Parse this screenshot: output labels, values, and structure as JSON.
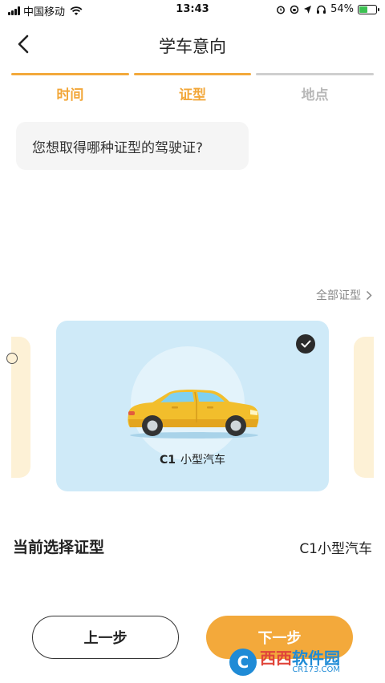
{
  "status_bar": {
    "carrier": "中国移动",
    "time": "13:43",
    "battery_text": "54%",
    "battery_level": 0.54,
    "battery_color": "#3cc152"
  },
  "header": {
    "back_icon": "chevron-left-icon",
    "title": "学车意向"
  },
  "steps": [
    {
      "label": "时间",
      "active": true
    },
    {
      "label": "证型",
      "active": true
    },
    {
      "label": "地点",
      "active": false
    }
  ],
  "question": "您想取得哪种证型的驾驶证?",
  "all_types_link": "全部证型",
  "carousel": {
    "selected_card": {
      "code": "C1",
      "name": "小型汽车",
      "selected": true,
      "icon": "car-icon"
    }
  },
  "current_selection": {
    "label": "当前选择证型",
    "value": "C1小型汽车"
  },
  "buttons": {
    "prev": "上一步",
    "next": "下一步"
  },
  "watermark": {
    "logo_letter": "C",
    "brand_first": "西西",
    "brand_rest": "软件园",
    "sub": "CR173.COM"
  },
  "colors": {
    "accent": "#f3a93b",
    "card_bg": "#cfeaf8",
    "side_card_bg": "#fdf1d6"
  }
}
